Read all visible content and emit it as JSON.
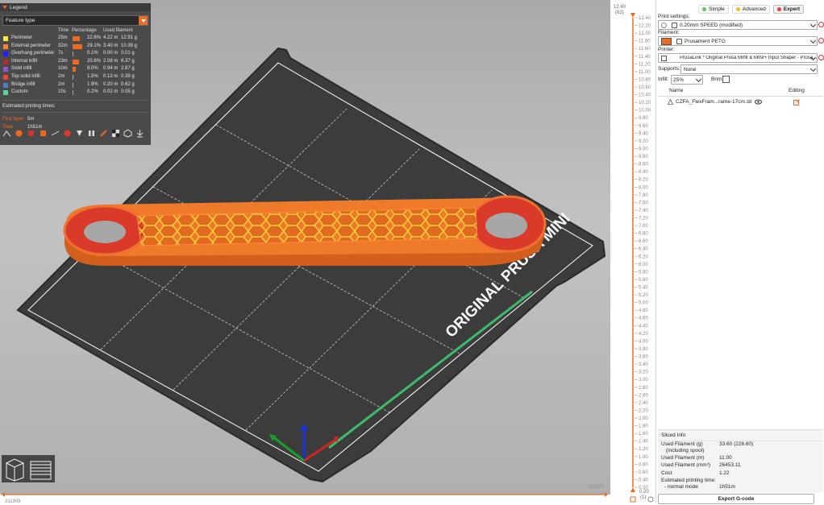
{
  "legend": {
    "title": "Legend",
    "feature_select": "Feature type",
    "columns": {
      "time": "Time",
      "percentage": "Percentage",
      "used_filament": "Used filament"
    },
    "rows": [
      {
        "name": "Perimeter",
        "color": "#ffe63c",
        "time": "25m",
        "percent": "22.6%",
        "meters": "4.22 m",
        "grams": "12.91 g",
        "fraction": 0.226
      },
      {
        "name": "External perimeter",
        "color": "#ff7d38",
        "time": "32m",
        "percent": "29.1%",
        "meters": "3.40 m",
        "grams": "10.39 g",
        "fraction": 0.291
      },
      {
        "name": "Overhang perimeter",
        "color": "#1f1fff",
        "time": "7s",
        "percent": "0.1%",
        "meters": "0.00 m",
        "grams": "0.01 g",
        "fraction": 0.001
      },
      {
        "name": "Internal infill",
        "color": "#b03029",
        "time": "23m",
        "percent": "20.6%",
        "meters": "2.08 m",
        "grams": "6.37 g",
        "fraction": 0.206
      },
      {
        "name": "Solid infill",
        "color": "#9654cc",
        "time": "10m",
        "percent": "9.0%",
        "meters": "0.94 m",
        "grams": "2.87 g",
        "fraction": 0.09
      },
      {
        "name": "Top solid infill",
        "color": "#f04040",
        "time": "2m",
        "percent": "1.5%",
        "meters": "0.13 m",
        "grams": "0.39 g",
        "fraction": 0.015
      },
      {
        "name": "Bridge infill",
        "color": "#4d80ba",
        "time": "2m",
        "percent": "1.9%",
        "meters": "0.20 m",
        "grams": "0.62 g",
        "fraction": 0.019
      },
      {
        "name": "Custom",
        "color": "#5ed194",
        "time": "10s",
        "percent": "0.2%",
        "meters": "0.02 m",
        "grams": "0.05 g",
        "fraction": 0.002
      }
    ],
    "estimated_label": "Estimated printing times:",
    "first_layer_label": "First layer",
    "first_layer_value": "5m",
    "total_label": "Total",
    "total_value": "1h51m"
  },
  "bed_label": "ORIGINAL PRUSA MINI",
  "hslider": {
    "left_value": "311908",
    "right_value": "312377"
  },
  "vslider": {
    "top_value": "12.40",
    "top_layer": "(62)",
    "bottom_value": "0.20",
    "bottom_layer": "(1)",
    "ticks": [
      "12.40",
      "12.20",
      "12.00",
      "11.80",
      "11.60",
      "11.40",
      "11.20",
      "11.00",
      "10.80",
      "10.60",
      "10.40",
      "10.20",
      "10.00",
      "9.80",
      "9.60",
      "9.40",
      "9.20",
      "9.00",
      "8.80",
      "8.60",
      "8.40",
      "8.20",
      "8.00",
      "7.80",
      "7.60",
      "7.40",
      "7.20",
      "7.00",
      "6.80",
      "6.60",
      "6.40",
      "6.20",
      "6.00",
      "5.80",
      "5.60",
      "5.40",
      "5.20",
      "5.00",
      "4.80",
      "4.60",
      "4.40",
      "4.20",
      "4.00",
      "3.80",
      "3.60",
      "3.40",
      "3.20",
      "3.00",
      "2.80",
      "2.60",
      "2.40",
      "2.20",
      "2.00",
      "1.80",
      "1.60",
      "1.40",
      "1.20",
      "1.00",
      "0.80",
      "0.60",
      "0.40",
      "0.20"
    ]
  },
  "panel": {
    "modes": [
      {
        "label": "Simple",
        "color": "#5ec45e"
      },
      {
        "label": "Advanced",
        "color": "#f0c020"
      },
      {
        "label": "Expert",
        "color": "#e04040"
      }
    ],
    "print_settings_label": "Print settings:",
    "print_settings_value": "0.20mm SPEED (modified)",
    "filament_label": "Filament:",
    "filament_value": "Prusament PETG",
    "filament_color": "#ed6b21",
    "printer_label": "Printer:",
    "printer_value": "PrusaLink * Original Prusa MINI & MINI+ Input Shaper - Prusa...",
    "supports_label": "Supports:",
    "supports_value": "None",
    "infill_label": "Infill:",
    "infill_value": "25%",
    "brim_label": "Brim:",
    "objects_name_header": "Name",
    "objects_editing_header": "Editing",
    "object_name": "CZFA_FlexFram...rame-17cm.stl"
  },
  "sliced": {
    "title": "Sliced Info",
    "used_filament_g_label": "Used Filament (g)",
    "including_spool_label": "(including spool)",
    "used_filament_g_value": "33.60 (226.60)",
    "used_filament_m_label": "Used Filament (m)",
    "used_filament_m_value": "11.00",
    "used_filament_mm3_label": "Used Filament (mm³)",
    "used_filament_mm3_value": "26453.11",
    "cost_label": "Cost",
    "cost_value": "1.22",
    "est_time_label": "Estimated printing time:",
    "normal_mode_label": "- normal mode",
    "est_time_value": "1h51m"
  },
  "export_label": "Export G-code"
}
